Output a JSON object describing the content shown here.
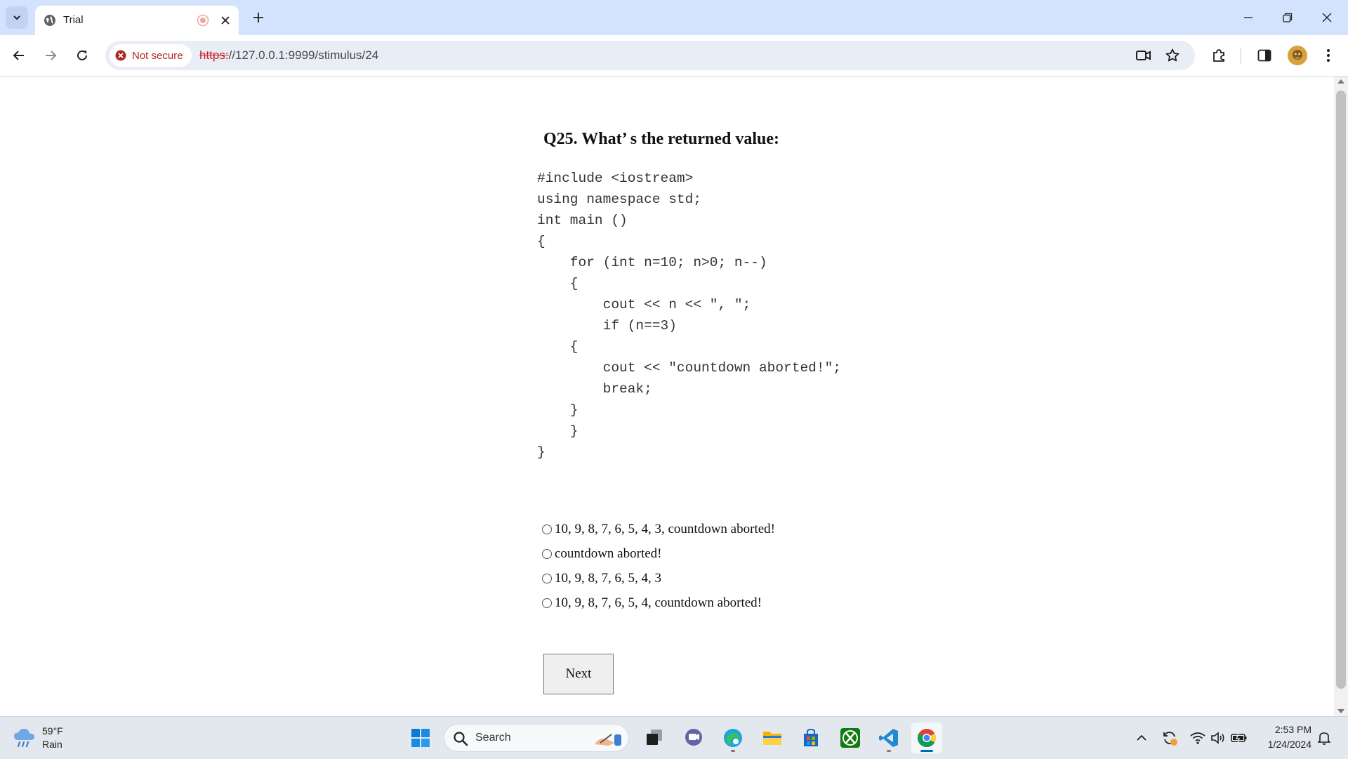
{
  "browser": {
    "tab_title": "Trial",
    "security_label": "Not secure",
    "url_scheme": "https:",
    "url_rest": "//127.0.0.1:9999/stimulus/24"
  },
  "page": {
    "question": "Q25. What’ s the returned value:",
    "code_lines": [
      "#include <iostream>",
      "using namespace std;",
      "int main ()",
      "{",
      "    for (int n=10; n>0; n--)",
      "    {",
      "        cout << n << \", \";",
      "        if (n==3)",
      "    {",
      "        cout << \"countdown aborted!\";",
      "        break;",
      "    }",
      "    }",
      "}"
    ],
    "options": [
      "10, 9, 8, 7, 6, 5, 4, 3, countdown aborted!",
      "countdown aborted!",
      "10, 9, 8, 7, 6, 5, 4, 3",
      "10, 9, 8, 7, 6, 5, 4, countdown aborted!"
    ],
    "next_label": "Next"
  },
  "taskbar": {
    "weather_temp": "59°F",
    "weather_desc": "Rain",
    "search_label": "Search",
    "time": "2:53 PM",
    "date": "1/24/2024"
  },
  "colors": {
    "tabstrip_bg": "#d3e3fd",
    "omnibox_bg": "#e9eef6",
    "insecure_red": "#b3261e",
    "taskbar_bg": "#e3e8ee"
  }
}
